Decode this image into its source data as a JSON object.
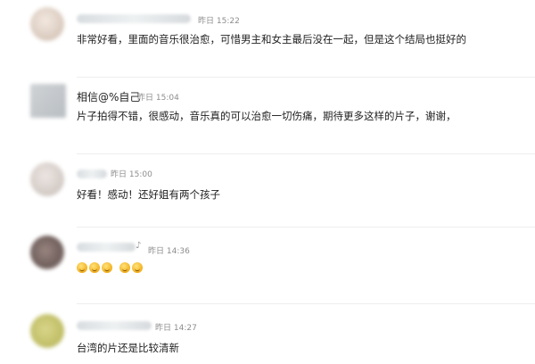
{
  "comments": [
    {
      "user": "",
      "time": "昨日 15:22",
      "text": "非常好看，里面的音乐很治愈，可惜男主和女主最后没在一起，但是这个结局也挺好的"
    },
    {
      "user": "相信@%自己",
      "time": "昨日 15:04",
      "text": "片子拍得不错，很感动，音乐真的可以治愈一切伤痛，期待更多这样的片子，谢谢，"
    },
    {
      "user": "",
      "time": "昨日 15:00",
      "text": "好看！感动！还好姐有两个孩子"
    },
    {
      "user": "",
      "time": "昨日 14:36",
      "text": "",
      "emoji": [
        "laughing-emoji",
        "laughing-emoji",
        "laughing-emoji",
        "smile-emoji",
        "smile-emoji"
      ]
    },
    {
      "user": "",
      "time": "昨日 14:27",
      "text": "台湾的片还是比较清新"
    }
  ],
  "colors": {
    "time": "#8d8d8d",
    "divider": "#eeeeee",
    "text": "#1e1e1e"
  }
}
